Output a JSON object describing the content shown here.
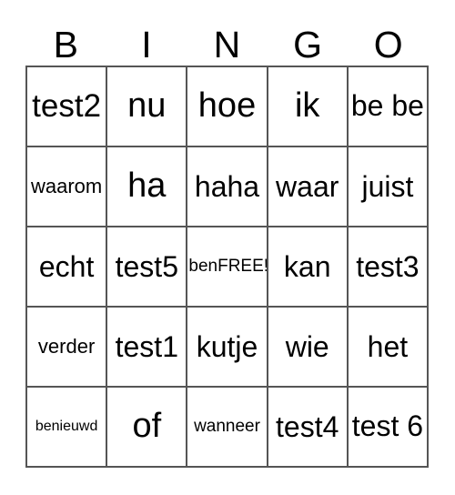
{
  "header": {
    "letters": [
      "B",
      "I",
      "N",
      "G",
      "O"
    ]
  },
  "grid": {
    "columns": 5,
    "rows": 5,
    "border_color": "#555555",
    "background_color": "#ffffff",
    "text_color": "#000000",
    "cells": [
      [
        {
          "text": "test2",
          "size": "fs-lg",
          "lines": 1
        },
        {
          "text": "nu",
          "size": "fs-xl",
          "lines": 1
        },
        {
          "text": "hoe",
          "size": "fs-xl",
          "lines": 1
        },
        {
          "text": "ik",
          "size": "fs-xl",
          "lines": 1
        },
        {
          "text": "be be",
          "size": "fs-md",
          "lines": 2
        }
      ],
      [
        {
          "text": "waarom",
          "size": "fs-sm",
          "lines": 1
        },
        {
          "text": "ha",
          "size": "fs-xl",
          "lines": 1
        },
        {
          "text": "haha",
          "size": "fs-md",
          "lines": 1
        },
        {
          "text": "waar",
          "size": "fs-md",
          "lines": 1
        },
        {
          "text": "juist",
          "size": "fs-md",
          "lines": 1
        }
      ],
      [
        {
          "text": "echt",
          "size": "fs-md",
          "lines": 1
        },
        {
          "text": "test5",
          "size": "fs-md",
          "lines": 1
        },
        {
          "text": "benFREE!",
          "size": "fs-xs",
          "lines": 1
        },
        {
          "text": "kan",
          "size": "fs-md",
          "lines": 1
        },
        {
          "text": "test3",
          "size": "fs-md",
          "lines": 1
        }
      ],
      [
        {
          "text": "verder",
          "size": "fs-sm",
          "lines": 1
        },
        {
          "text": "test1",
          "size": "fs-md",
          "lines": 1
        },
        {
          "text": "kutje",
          "size": "fs-md",
          "lines": 1
        },
        {
          "text": "wie",
          "size": "fs-md",
          "lines": 1
        },
        {
          "text": "het",
          "size": "fs-md",
          "lines": 1
        }
      ],
      [
        {
          "text": "benieuwd",
          "size": "fs-xxs",
          "lines": 1
        },
        {
          "text": "of",
          "size": "fs-xl",
          "lines": 1
        },
        {
          "text": "wanneer",
          "size": "fs-xs",
          "lines": 1
        },
        {
          "text": "test4",
          "size": "fs-md",
          "lines": 1
        },
        {
          "text": "test 6",
          "size": "fs-md",
          "lines": 2
        }
      ]
    ]
  }
}
